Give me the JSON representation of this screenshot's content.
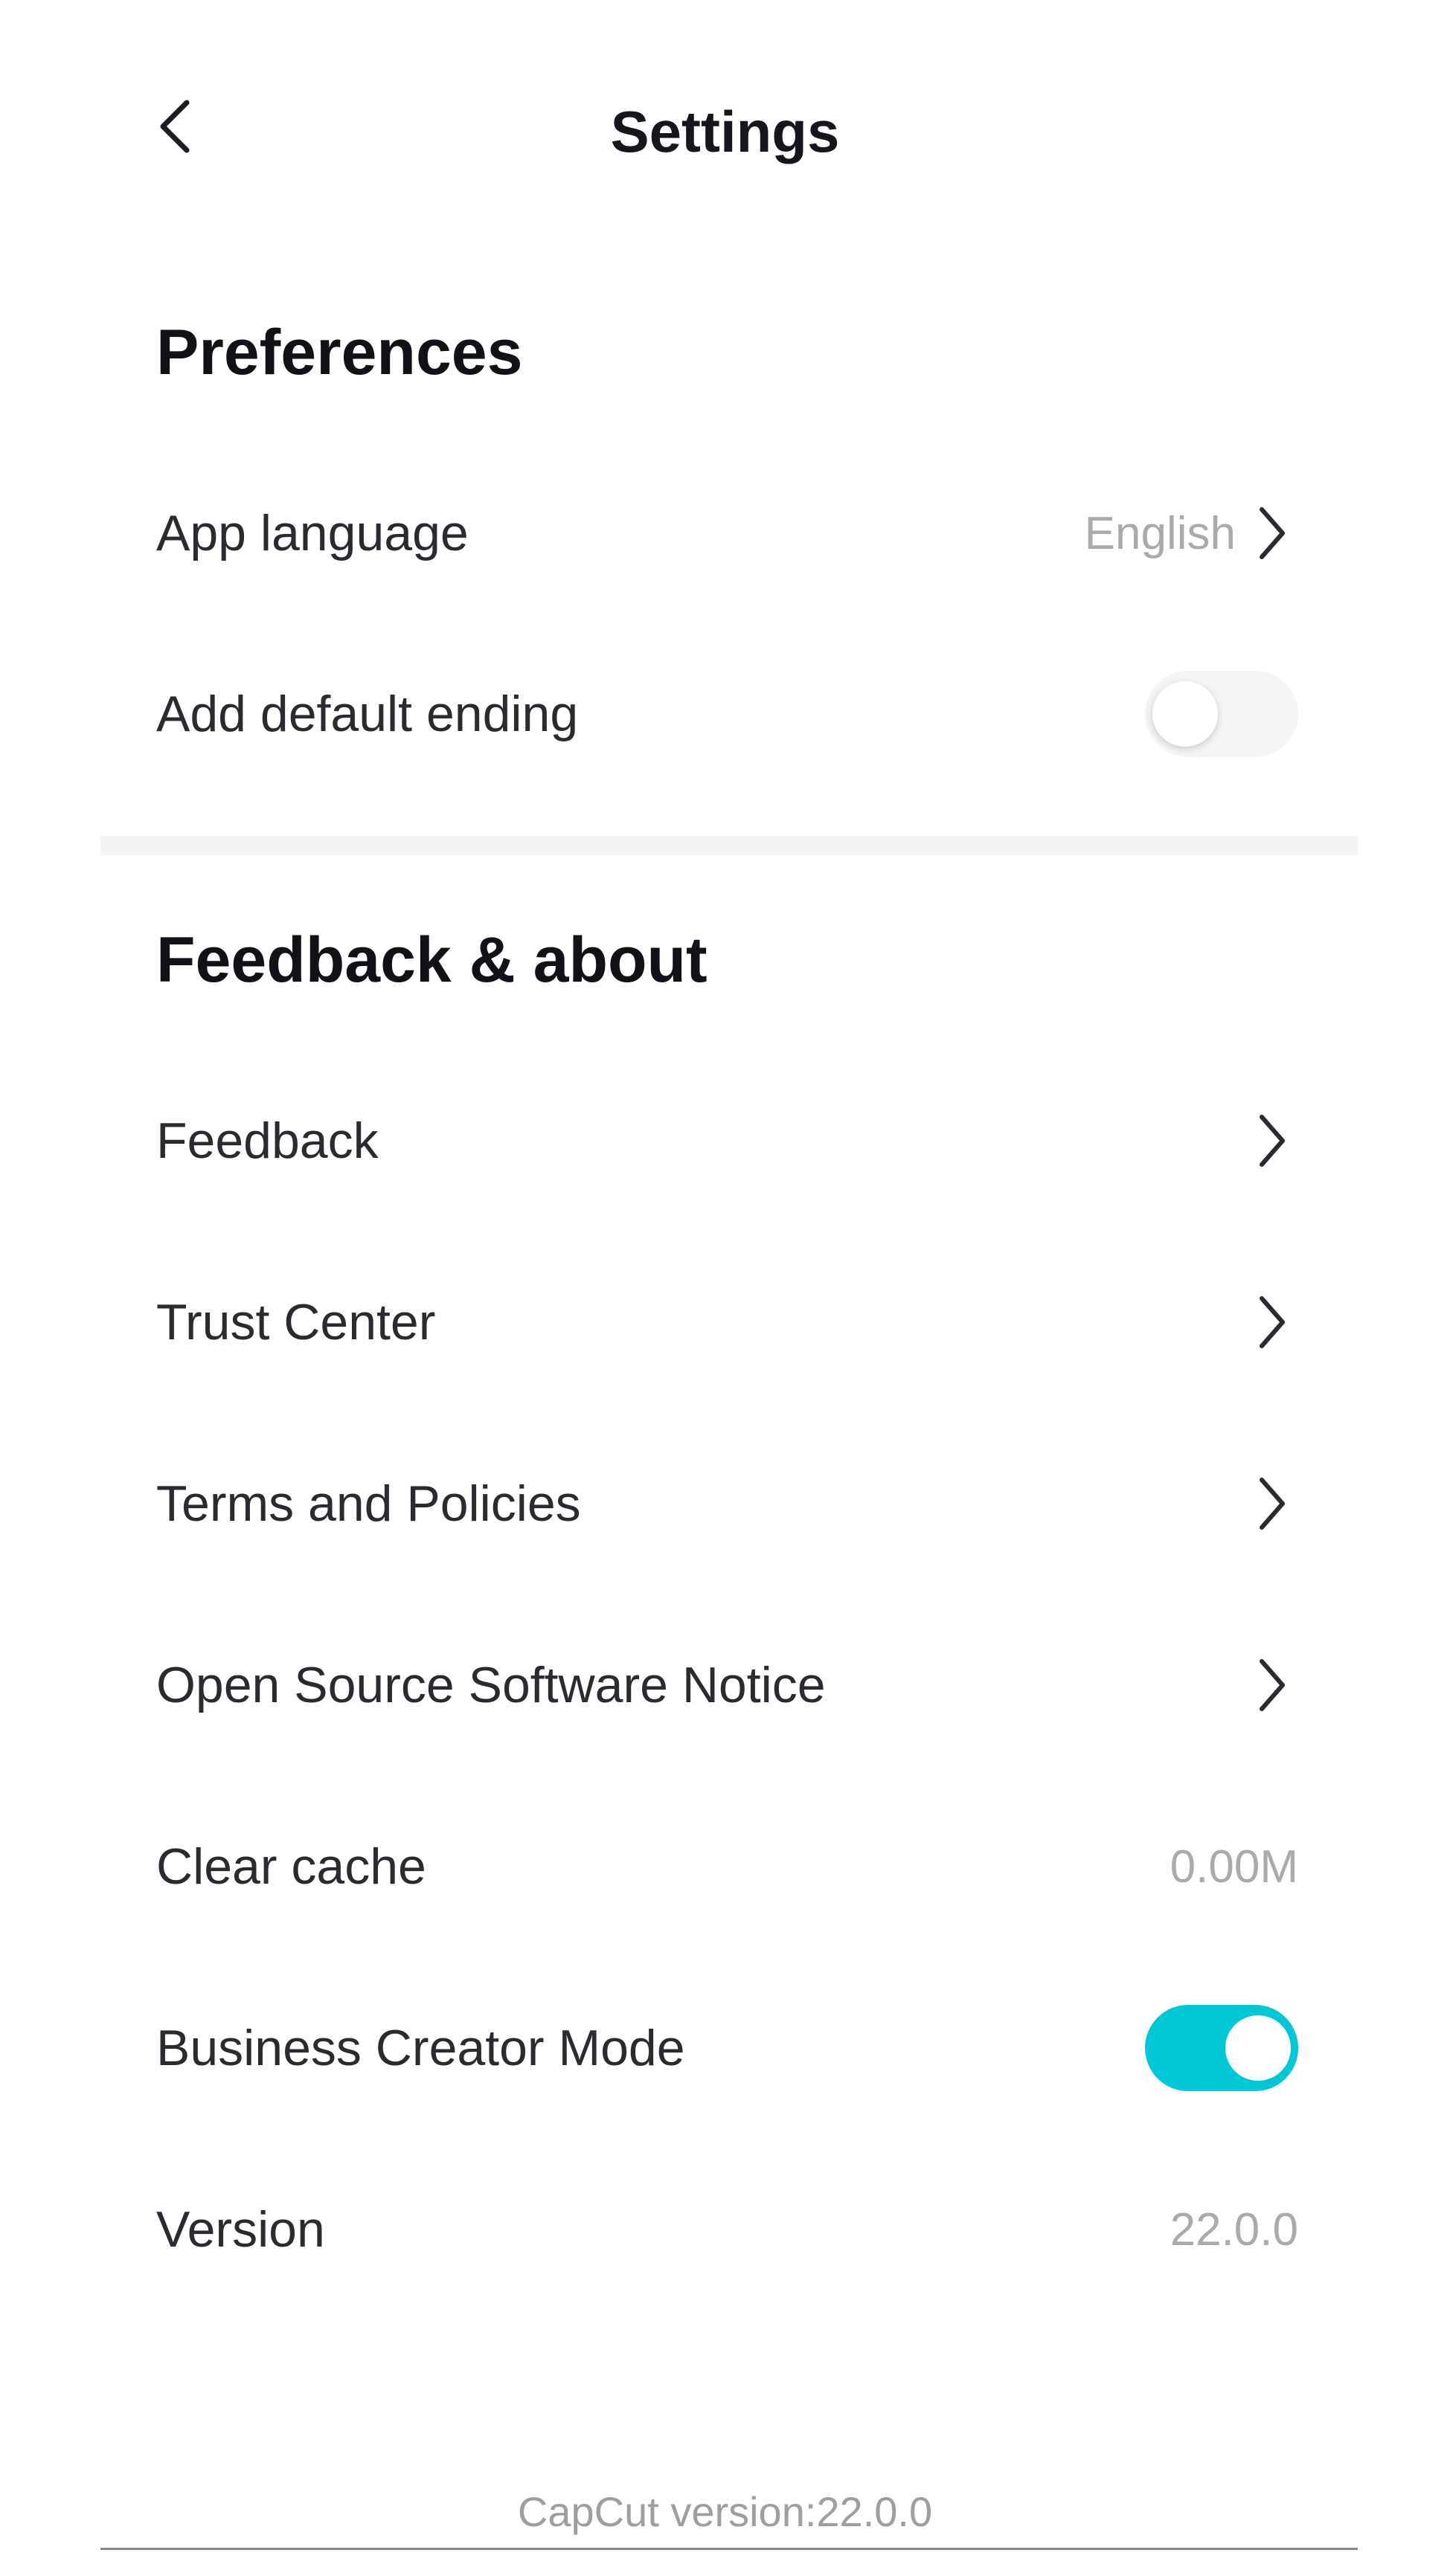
{
  "header": {
    "title": "Settings",
    "back_icon": "chevron-left-icon"
  },
  "preferences": {
    "title": "Preferences",
    "app_language": {
      "label": "App language",
      "value": "English"
    },
    "default_ending": {
      "label": "Add default ending",
      "enabled": false
    }
  },
  "feedback_about": {
    "title": "Feedback & about",
    "items": [
      {
        "label": "Feedback"
      },
      {
        "label": "Trust Center"
      },
      {
        "label": "Terms and Policies"
      },
      {
        "label": "Open Source Software Notice"
      }
    ],
    "clear_cache": {
      "label": "Clear cache",
      "value": "0.00M"
    },
    "business_creator": {
      "label": "Business Creator Mode",
      "enabled": true
    },
    "version": {
      "label": "Version",
      "value": "22.0.0"
    }
  },
  "footer": {
    "text": "CapCut version:22.0.0"
  },
  "colors": {
    "accent": "#00c6d6",
    "text": "#2a2a30",
    "muted": "#a9a9ae"
  }
}
